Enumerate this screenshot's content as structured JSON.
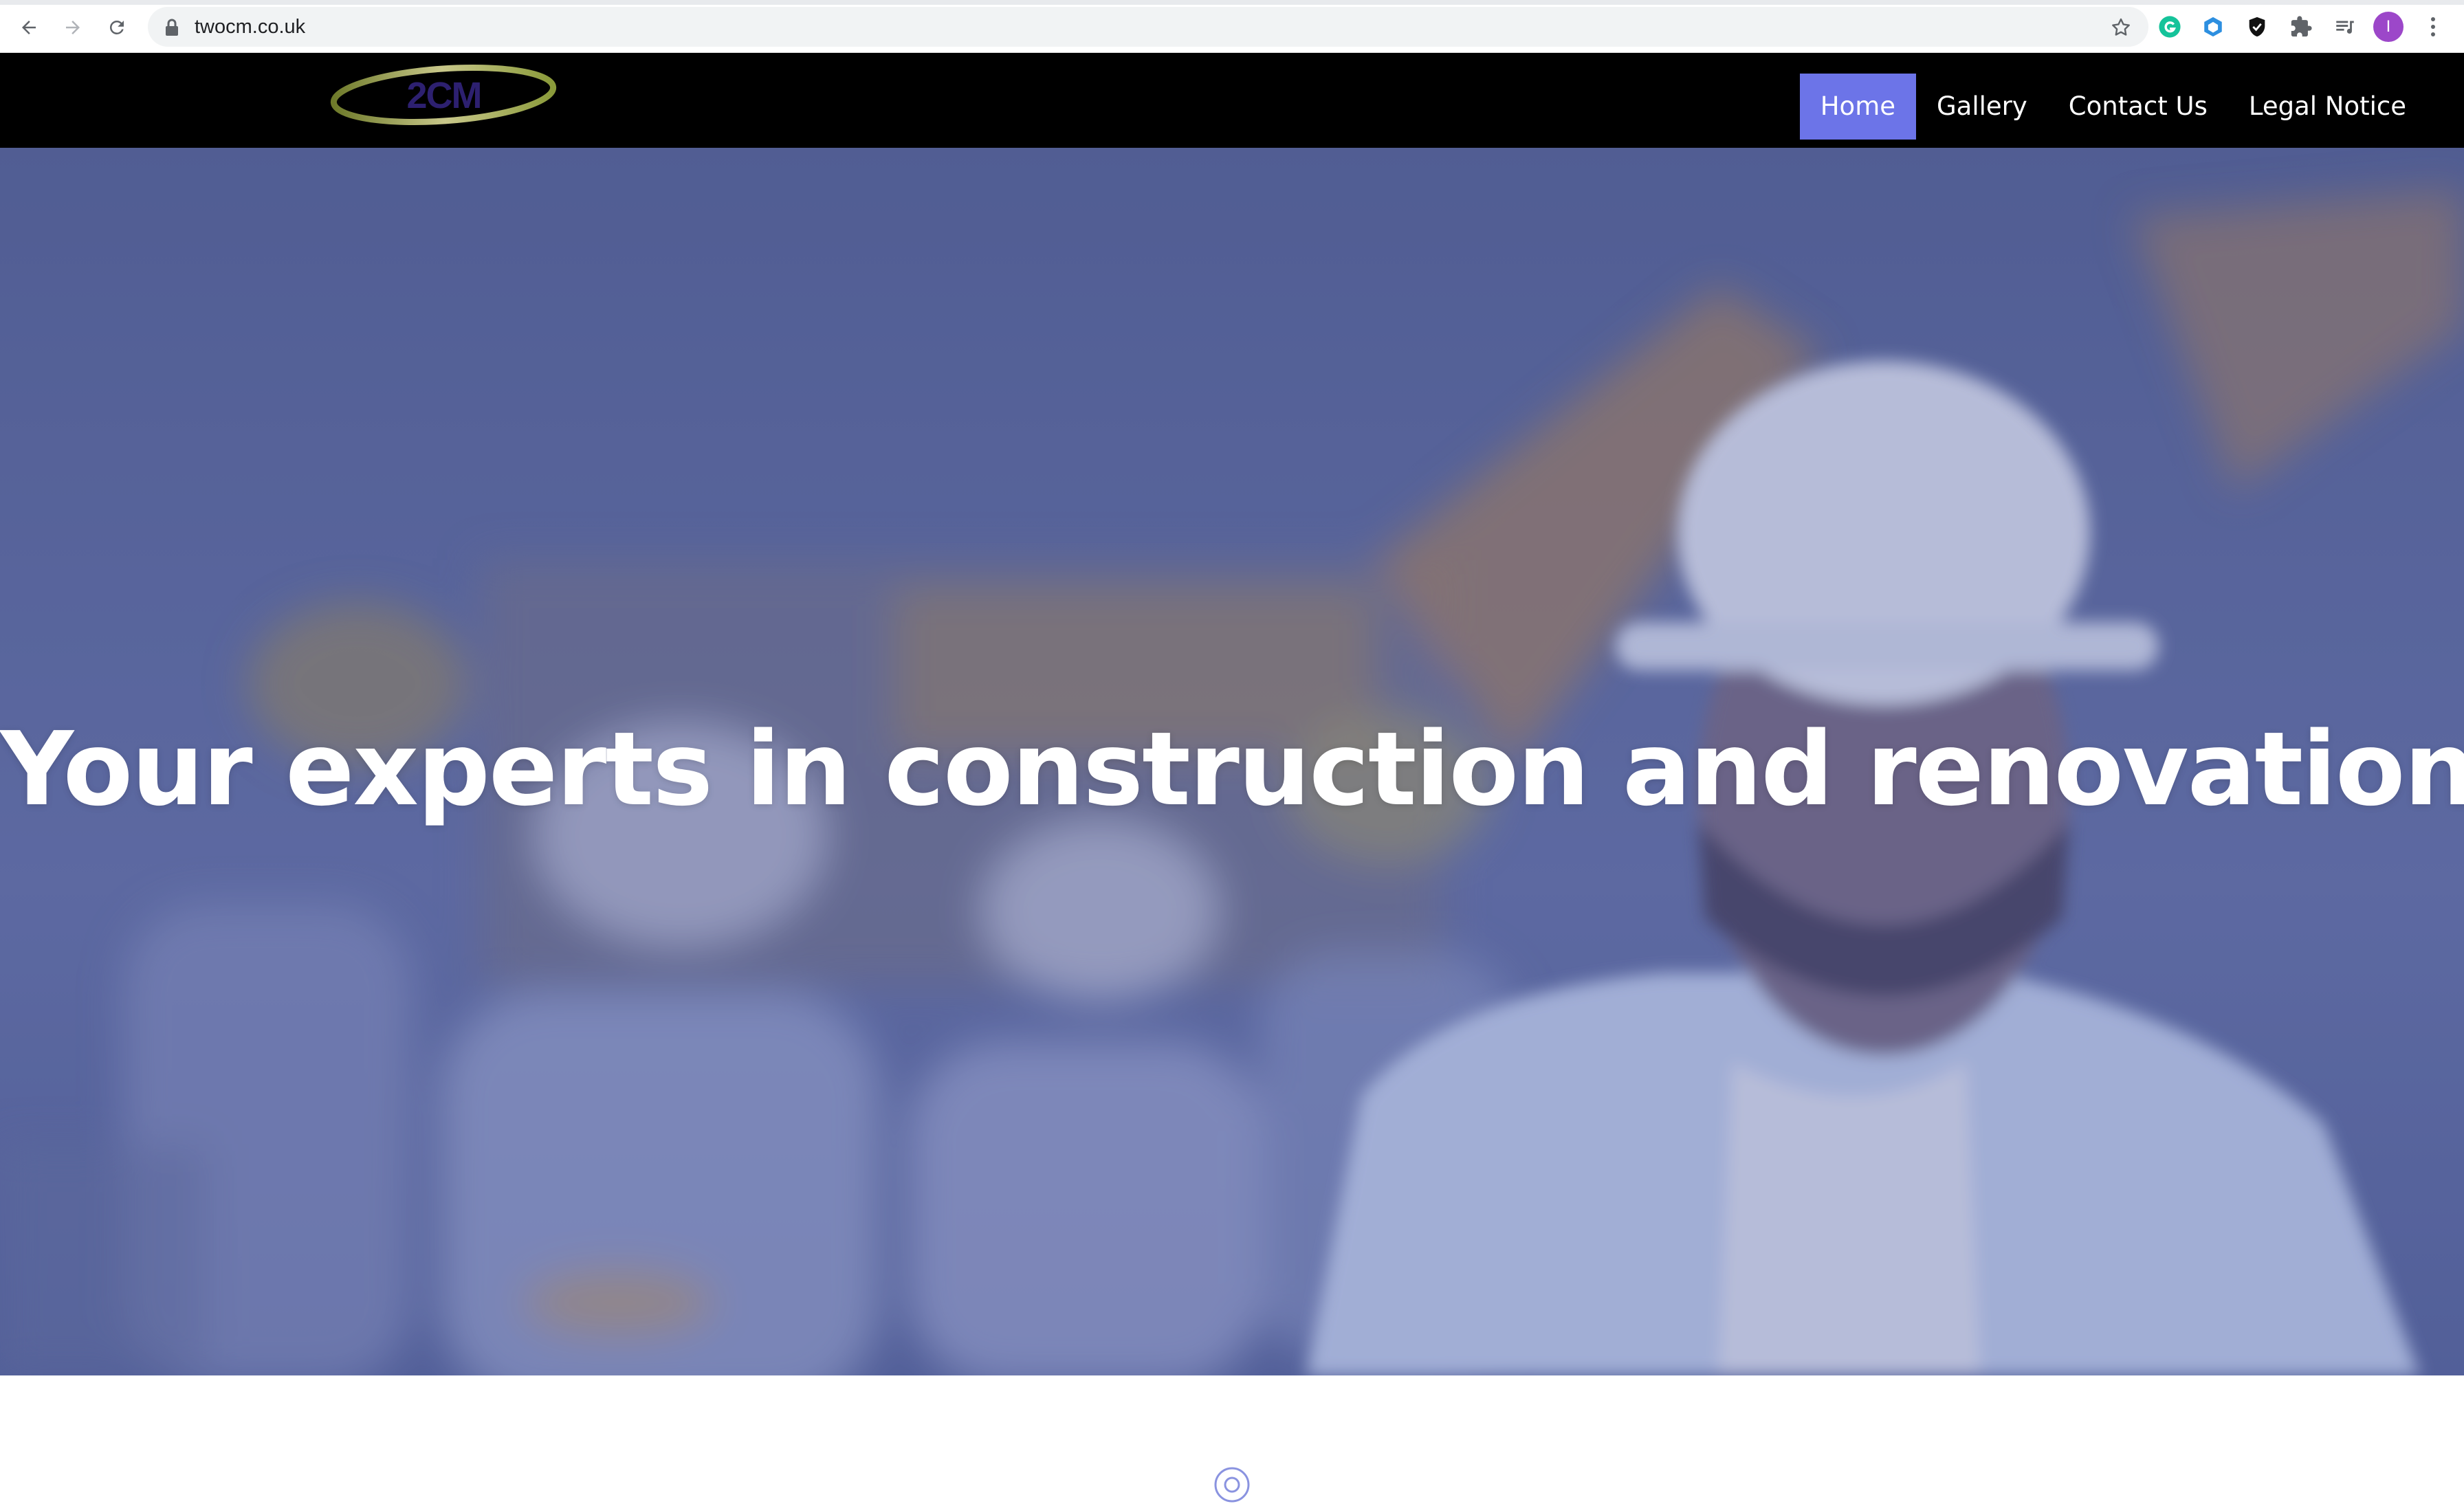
{
  "browser": {
    "url": "twocm.co.uk",
    "avatar_initial": "I",
    "icons": [
      "back-arrow-icon",
      "forward-arrow-icon",
      "reload-icon",
      "lock-icon",
      "star-icon",
      "grammarly-icon",
      "extension-cube-icon",
      "shield-icon",
      "puzzle-icon",
      "playlist-icon",
      "kebab-menu-icon"
    ]
  },
  "site": {
    "logo_text": "2CM",
    "nav": [
      {
        "label": "Home",
        "active": true
      },
      {
        "label": "Gallery",
        "active": false
      },
      {
        "label": "Contact Us",
        "active": false
      },
      {
        "label": "Legal Notice",
        "active": false
      }
    ],
    "hero_title": "Your experts in construction and renovations"
  },
  "colors": {
    "header_bg": "#000000",
    "nav_active": "#6c74e8",
    "hero_tint": "#6572a6",
    "logo_ring": "#8a9a3a",
    "logo_text": "#2d2070"
  }
}
